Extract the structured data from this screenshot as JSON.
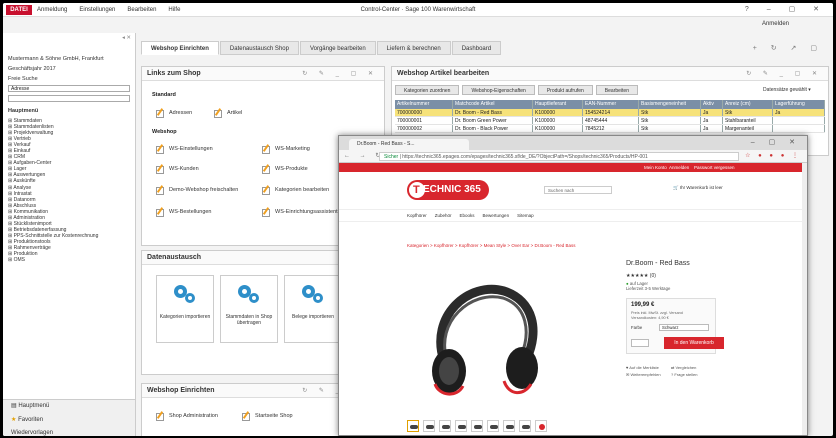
{
  "titlebar": {
    "file_label": "DATEI",
    "menu": [
      "Anmeldung",
      "Einstellungen",
      "Bearbeiten",
      "Hilfe"
    ],
    "app_title": "Control-Center · Sage 100 Warenwirtschaft",
    "login_label": "Anmelden"
  },
  "leftpane": {
    "company": "Mustermann & Söhne GmbH, Frankfurt",
    "fiscal_year": "Geschäftsjahr 2017",
    "search_label": "Freie Suche",
    "search_select": "Adresse",
    "tree_root": "Hauptmenü",
    "tree": [
      "Stammdaten",
      "Stammdatenlisten",
      "Projektverwaltung",
      "Vertrieb",
      "Verkauf",
      "Einkauf",
      "CRM",
      "Aufgaben-Center",
      "Lager",
      "Auswertungen",
      "Auskünfte",
      "Analyse",
      "Intrastat",
      "Datanorm",
      "Abschluss",
      "Kommunikation",
      "Administration",
      "Stücklistenimport",
      "Betriebsdatenerfassung",
      "PPS-Schnittstelle zur Kostenrechnung",
      "Produktionstools",
      "Rahmenverträge",
      "Produktion",
      "OMS"
    ],
    "bottom": [
      "Hauptmenü",
      "Favoriten",
      "Wiedervorlagen"
    ]
  },
  "tabs": [
    "Webshop Einrichten",
    "Datenaustausch Shop",
    "Vorgänge bearbeiten",
    "Liefern & berechnen",
    "Dashboard"
  ],
  "links_panel": {
    "title": "Links zum Shop",
    "section_standard": "Standard",
    "standard": [
      "Adressen",
      "Artikel"
    ],
    "section_webshop": "Webshop",
    "webshop_col1": [
      "WS-Einstellungen",
      "WS-Kunden",
      "Demo-Webshop freischalten",
      "WS-Bestellungen"
    ],
    "webshop_col2": [
      "WS-Marketing",
      "WS-Produkte",
      "Kategorien bearbeiten",
      "WS-Einrichtungsassistent"
    ]
  },
  "datenaustausch_panel": {
    "title": "Datenaustausch",
    "tiles": [
      "Kategorien importieren",
      "Stammdaten in Shop übertragen",
      "Belege importieren"
    ]
  },
  "webshop_panel": {
    "title": "Webshop Einrichten",
    "links": [
      "Shop Administration",
      "Startseite Shop"
    ]
  },
  "artikel_panel": {
    "title": "Webshop Artikel bearbeiten",
    "buttons": [
      "Kategorien zuordnen",
      "Webshop-Eigenschaften",
      "Produkt aufrufen",
      "Bearbeiten"
    ],
    "filter": "Datensätze gewählt",
    "columns": [
      "Artikelnummer",
      "Matchcode Artikel",
      "Hauptlieferant",
      "EAN-Nummer",
      "Basismengeneinheit",
      "Aktiv",
      "Anreiz (cm)",
      "Lagerführung"
    ],
    "rows": [
      [
        "700000000",
        "Dr. Boom - Red Bass",
        "K100000",
        "154524214",
        "Stk",
        "Ja",
        "Stk",
        "Ja"
      ],
      [
        "700000001",
        "Dr. Boom Green Power",
        "K100000",
        "48745444",
        "Stk",
        "Ja",
        "Stahlbaranteil",
        ""
      ],
      [
        "700000002",
        "Dr. Boom - Black Power",
        "K100000",
        "7845212",
        "Stk",
        "Ja",
        "Margenanteil",
        ""
      ]
    ]
  },
  "browser": {
    "tab_title": "Dr.Boom - Red Bass - S...",
    "url_secure": "Sicher",
    "url": "https://technic365.epages.com/epages/technic365.sf/de_DE/?ObjectPath=/Shops/technic365/Products/HP-001",
    "topbar": [
      "Mein Konto",
      "Anmelden",
      "Passwort vergessen"
    ],
    "logo": "ECHNIC 365",
    "search_placeholder": "Suchen nach",
    "cart_text": "Ihr Warenkorb ist leer",
    "nav": [
      "Kopfhörer",
      "Zubehör",
      "Ebooks",
      "Bewertungen",
      "Sitemap"
    ],
    "breadcrumb": "Kategorien > Kopfhörer > Kopfhörer > Mean Style > Over Ear > Dr.Boom - Red Bass",
    "product_name": "Dr.Boom - Red Bass",
    "stars": "★★★★★ (0)",
    "meta": [
      "auf Lager",
      "Lieferzeit 3-5 Werktage"
    ],
    "price": "199,99 €",
    "price_note": [
      "Preis inkl. MwSt. zzgl. Versand",
      "Versandkosten: 4,90 €"
    ],
    "farbe_label": "Farbe",
    "farbe_value": "Schwarz",
    "cart_button": "In den Warenkorb",
    "links": [
      "Auf die Merkliste",
      "Vergleichen",
      "Weiterempfehlen",
      "Frage stellen"
    ]
  }
}
